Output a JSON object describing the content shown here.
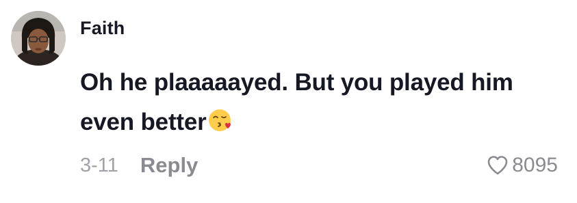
{
  "comment": {
    "username": "Faith",
    "text": "Oh he plaaaaayed. But you played him even better",
    "emoji": "kissing-face-with-heart-emoji",
    "date": "3-11",
    "reply_label": "Reply",
    "like_count": "8095"
  },
  "colors": {
    "text_primary": "#161823",
    "text_secondary": "#8a8b91",
    "text_tertiary": "#a1a2a7"
  }
}
